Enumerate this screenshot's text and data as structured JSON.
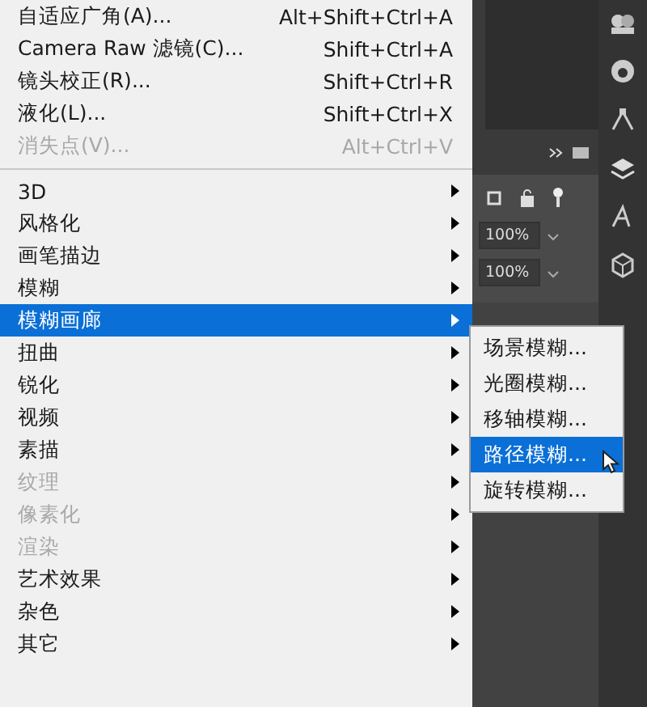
{
  "menu": {
    "top_items": [
      {
        "label": "自适应广角(A)...",
        "shortcut": "Alt+Shift+Ctrl+A",
        "disabled": false
      },
      {
        "label": "Camera Raw 滤镜(C)...",
        "shortcut": "Shift+Ctrl+A",
        "disabled": false
      },
      {
        "label": "镜头校正(R)...",
        "shortcut": "Shift+Ctrl+R",
        "disabled": false
      },
      {
        "label": "液化(L)...",
        "shortcut": "Shift+Ctrl+X",
        "disabled": false
      },
      {
        "label": "消失点(V)...",
        "shortcut": "Alt+Ctrl+V",
        "disabled": true
      }
    ],
    "items": [
      {
        "label": "3D",
        "disabled": false,
        "selected": false
      },
      {
        "label": "风格化",
        "disabled": false,
        "selected": false
      },
      {
        "label": "画笔描边",
        "disabled": false,
        "selected": false
      },
      {
        "label": "模糊",
        "disabled": false,
        "selected": false
      },
      {
        "label": "模糊画廊",
        "disabled": false,
        "selected": true
      },
      {
        "label": "扭曲",
        "disabled": false,
        "selected": false
      },
      {
        "label": "锐化",
        "disabled": false,
        "selected": false
      },
      {
        "label": "视频",
        "disabled": false,
        "selected": false
      },
      {
        "label": "素描",
        "disabled": false,
        "selected": false
      },
      {
        "label": "纹理",
        "disabled": true,
        "selected": false
      },
      {
        "label": "像素化",
        "disabled": true,
        "selected": false
      },
      {
        "label": "渲染",
        "disabled": true,
        "selected": false
      },
      {
        "label": "艺术效果",
        "disabled": false,
        "selected": false
      },
      {
        "label": "杂色",
        "disabled": false,
        "selected": false
      },
      {
        "label": "其它",
        "disabled": false,
        "selected": false
      }
    ]
  },
  "submenu": {
    "items": [
      {
        "label": "场景模糊...",
        "selected": false
      },
      {
        "label": "光圈模糊...",
        "selected": false
      },
      {
        "label": "移轴模糊...",
        "selected": false
      },
      {
        "label": "路径模糊...",
        "selected": true
      },
      {
        "label": "旋转模糊...",
        "selected": false
      }
    ]
  },
  "panel": {
    "opacity_value": "100%",
    "fill_value": "100%"
  }
}
